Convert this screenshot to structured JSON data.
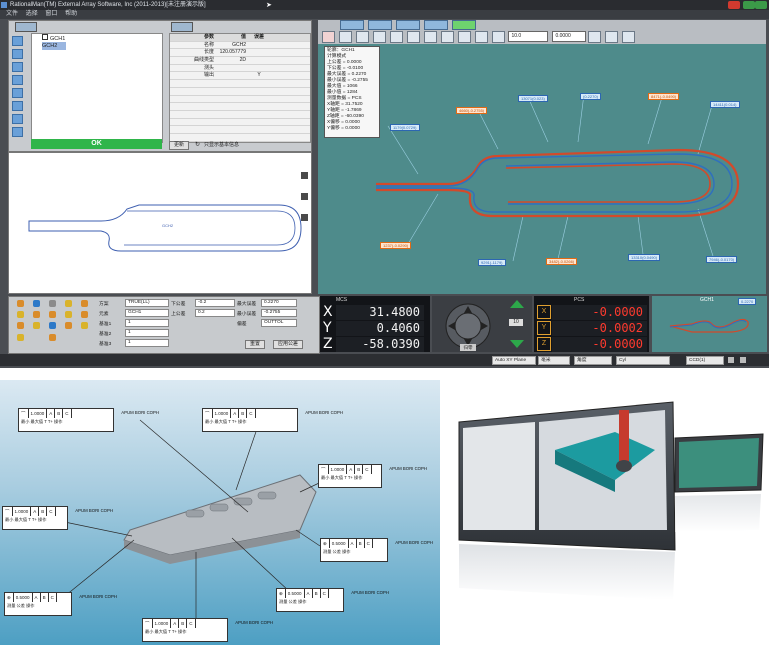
{
  "app": {
    "title": "RationalMan(TM) External Array Software, Inc (2011-2013)[未注册演示版]",
    "menu": [
      "文件",
      "选择",
      "窗口",
      "帮助"
    ]
  },
  "element_panel": {
    "tab_label": "元素",
    "items": [
      {
        "label": "GCH1"
      },
      {
        "label": "GCH2"
      }
    ],
    "ok_label": "OK"
  },
  "property_table": {
    "headers": [
      "参数",
      "值",
      "误差"
    ],
    "rows": [
      {
        "name": "名称",
        "value": "GCH2",
        "tol": ""
      },
      {
        "name": "长度",
        "value": "120.057779",
        "tol": ""
      },
      {
        "name": "曲线类型",
        "value": "2D",
        "tol": ""
      },
      {
        "name": "测头",
        "value": "",
        "tol": ""
      },
      {
        "name": "输出",
        "value": "",
        "tol": "Y"
      }
    ],
    "btn_apply": "更新",
    "btn_only_base": "只显示基本信息"
  },
  "preview": {
    "label": "GCH2"
  },
  "viewport": {
    "scale_value": "10.0",
    "offset_value": "0.0000",
    "info_lines": [
      "轮廓：GCH1",
      "计算模式",
      "上公差 = 0.0000",
      "下公差 = -0.0100",
      "最大误差 = 0.2270",
      "最小误差 = -0.2755",
      "最大值 = 1066",
      "最小值 = 1284",
      "测量数据 = PCS",
      "X轴距 = 31.7520",
      "Y轴距 = -1.7869",
      "Z轴距 = -60.0390",
      "X偏移 = 0.0000",
      "Y偏移 = 0.0000",
      "Z偏移 = -0.1950"
    ],
    "callouts": [
      {
        "text": "1179(0.0729)",
        "tone": "blue"
      },
      {
        "text": "4660(-0.2755)",
        "tone": "orange"
      },
      {
        "text": "13071(0.023)",
        "tone": "blue"
      },
      {
        "text": "(0.2270)",
        "tone": "blue"
      },
      {
        "text": "8471(-0.0490)",
        "tone": "orange"
      },
      {
        "text": "14411(0.014)",
        "tone": "blue"
      },
      {
        "text": "1237(-0.0290)",
        "tone": "orange"
      },
      {
        "text": "9291(-1179)",
        "tone": "blue"
      },
      {
        "text": "3482(-0.0266)",
        "tone": "orange"
      },
      {
        "text": "13310(0.0490)",
        "tone": "blue"
      },
      {
        "text": "7946(-0.0170)",
        "tone": "blue"
      }
    ]
  },
  "controls": {
    "labels": [
      "方案",
      "元素",
      "基准1",
      "基准2",
      "基准3"
    ],
    "values": [
      "TRUE(LL)",
      "GCH1",
      "1",
      "1",
      "1"
    ],
    "tol_labels": [
      "下公差",
      "上公差",
      "最大误差",
      "最小误差",
      "偏差"
    ],
    "tol_values": [
      "-0.2",
      "0.2",
      "0.2270",
      "-0.2755",
      "OUTTOL"
    ],
    "btn_reset": "重置",
    "btn_apply": "应用公差"
  },
  "dro": {
    "header": "MCS",
    "axes": [
      {
        "axis": "X",
        "value": "31.4800"
      },
      {
        "axis": "Y",
        "value": "0.4060"
      },
      {
        "axis": "Z",
        "value": "-58.0390"
      }
    ]
  },
  "joystick": {
    "speed": "10",
    "zero_btn": "归零"
  },
  "dro2": {
    "header": "PCS",
    "axes": [
      {
        "axis": "X",
        "value": "-0.0000"
      },
      {
        "axis": "Y",
        "value": "-0.0002"
      },
      {
        "axis": "Z",
        "value": "-0.0000"
      }
    ]
  },
  "mini_view": {
    "label": "GCH1",
    "value": "0.2270"
  },
  "status": {
    "plane": "Auto XY Plane",
    "unit": "毫米",
    "angle": "角度",
    "coord": "Cyl",
    "code": "CCD(1)"
  },
  "render": {
    "fcf_items": [
      {
        "sym": "⌒",
        "tol": "1.0000",
        "d1": "A",
        "d2": "B",
        "d3": "C",
        "ref": "APUM BORI COPH",
        "line": "最小  最大值  T   T+   操作"
      },
      {
        "sym": "⌒",
        "tol": "1.0000",
        "d1": "A",
        "d2": "B",
        "d3": "C",
        "ref": "APUM BORI COPH",
        "line": "最小  最大值  T   T+   操作"
      },
      {
        "sym": "⌒",
        "tol": "1.0000",
        "d1": "A",
        "d2": "B",
        "d3": "C",
        "ref": "APUM BORI COPH",
        "line": "最小  最大值  T   T+   操作"
      },
      {
        "sym": "⌒",
        "tol": "1.0000",
        "d1": "A",
        "d2": "B",
        "d3": "C",
        "ref": "APUM BORI COPH",
        "line": "最小  最大值  T   T+   操作"
      },
      {
        "sym": "⊕",
        "tol": "0.5000",
        "d1": "A",
        "d2": "B",
        "d3": "C",
        "ref": "APUM BORI COPH",
        "line": "测量  公差   操作"
      },
      {
        "sym": "⊕",
        "tol": "0.5000",
        "d1": "A",
        "d2": "B",
        "d3": "C",
        "ref": "APUM BORI COPH",
        "line": "测量  公差   操作"
      },
      {
        "sym": "⊕",
        "tol": "0.5000",
        "d1": "A",
        "d2": "B",
        "d3": "C",
        "ref": "APUM BORI COPH",
        "line": "测量  公差   操作"
      },
      {
        "sym": "⌒",
        "tol": "1.0000",
        "d1": "A",
        "d2": "B",
        "d3": "C",
        "ref": "APUM BORI COPH",
        "line": "最小  最大值  T   T+   操作"
      }
    ]
  },
  "colors": {
    "ok": "#2fb54a",
    "viewport_bg": "#4e8b8b",
    "dro_red": "#ff3a2e"
  }
}
